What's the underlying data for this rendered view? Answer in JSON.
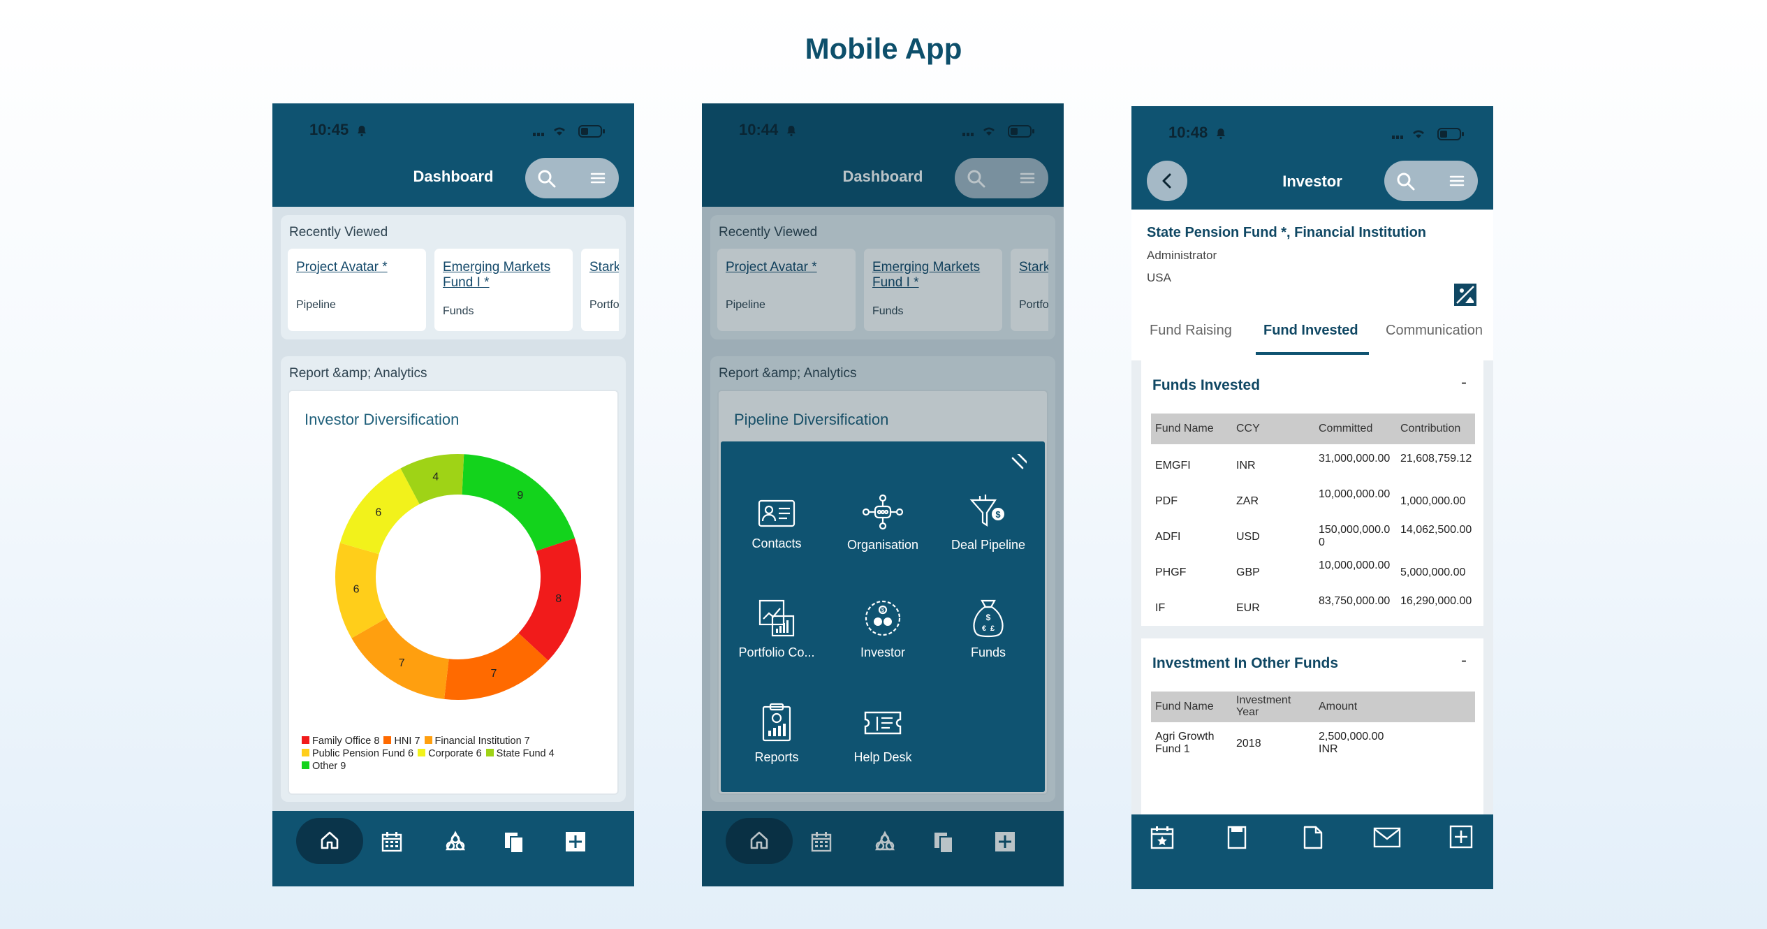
{
  "page_title": "Mobile App",
  "phone1": {
    "time": "10:45",
    "title": "Dashboard",
    "recently_viewed_label": "Recently Viewed",
    "recent": [
      {
        "title": "Project Avatar *",
        "category": "Pipeline"
      },
      {
        "title": "Emerging Markets Fund I *",
        "category": "Funds"
      },
      {
        "title": "Stark",
        "category": "Portfol"
      }
    ],
    "report_label": "Report &amp; Analytics",
    "chart_title": "Investor Diversification",
    "legend": [
      "Family Office 8",
      "HNI 7",
      "Financial Institution 7",
      "Public Pension Fund 6",
      "Corporate 6",
      "State Fund 4",
      "Other 9"
    ]
  },
  "chart_data": {
    "type": "pie",
    "title": "Investor Diversification",
    "labels": [
      "Family Office",
      "HNI",
      "Financial Institution",
      "Public Pension Fund",
      "Corporate",
      "State Fund",
      "Other"
    ],
    "values": [
      8,
      7,
      7,
      6,
      6,
      4,
      9
    ],
    "colors": [
      "#f11b1b",
      "#ff6a00",
      "#ff9f0f",
      "#ffce1a",
      "#f2f21b",
      "#9fd316",
      "#13d31c"
    ],
    "donut": true
  },
  "phone2": {
    "time": "10:44",
    "title": "Dashboard",
    "recently_viewed_label": "Recently Viewed",
    "recent": [
      {
        "title": "Project Avatar *",
        "category": "Pipeline"
      },
      {
        "title": "Emerging Markets Fund I *",
        "category": "Funds"
      },
      {
        "title": "Stark",
        "category": "Portfol"
      }
    ],
    "report_label": "Report &amp; Analytics",
    "chart_title": "Pipeline Diversification",
    "menu": [
      "Contacts",
      "Organisation",
      "Deal Pipeline",
      "Portfolio Co...",
      "Investor",
      "Funds",
      "Reports",
      "Help Desk"
    ]
  },
  "phone3": {
    "time": "10:48",
    "title": "Investor",
    "investor_name": "State Pension Fund *, Financial Institution",
    "role": "Administrator",
    "country": "USA",
    "tabs": [
      "Fund Raising",
      "Fund Invested",
      "Communication"
    ],
    "funds_invested": {
      "title": "Funds Invested",
      "toggle": "-",
      "headers": [
        "Fund Name",
        "CCY",
        "Committed",
        "Contribution"
      ],
      "rows": [
        [
          "EMGFI",
          "INR",
          "31,000,000.00",
          "21,608,759.12"
        ],
        [
          "PDF",
          "ZAR",
          "10,000,000.00",
          "1,000,000.00"
        ],
        [
          "ADFI",
          "USD",
          "150,000,000.00",
          "14,062,500.00"
        ],
        [
          "PHGF",
          "GBP",
          "10,000,000.00",
          "5,000,000.00"
        ],
        [
          "IF",
          "EUR",
          "83,750,000.00",
          "16,290,000.00"
        ]
      ]
    },
    "other_funds": {
      "title": "Investment In Other Funds",
      "toggle": "-",
      "headers": [
        "Fund Name",
        "Investment Year",
        "Amount"
      ],
      "rows": [
        [
          "Agri Growth Fund 1",
          "2018",
          "2,500,000.00 INR"
        ]
      ]
    }
  }
}
